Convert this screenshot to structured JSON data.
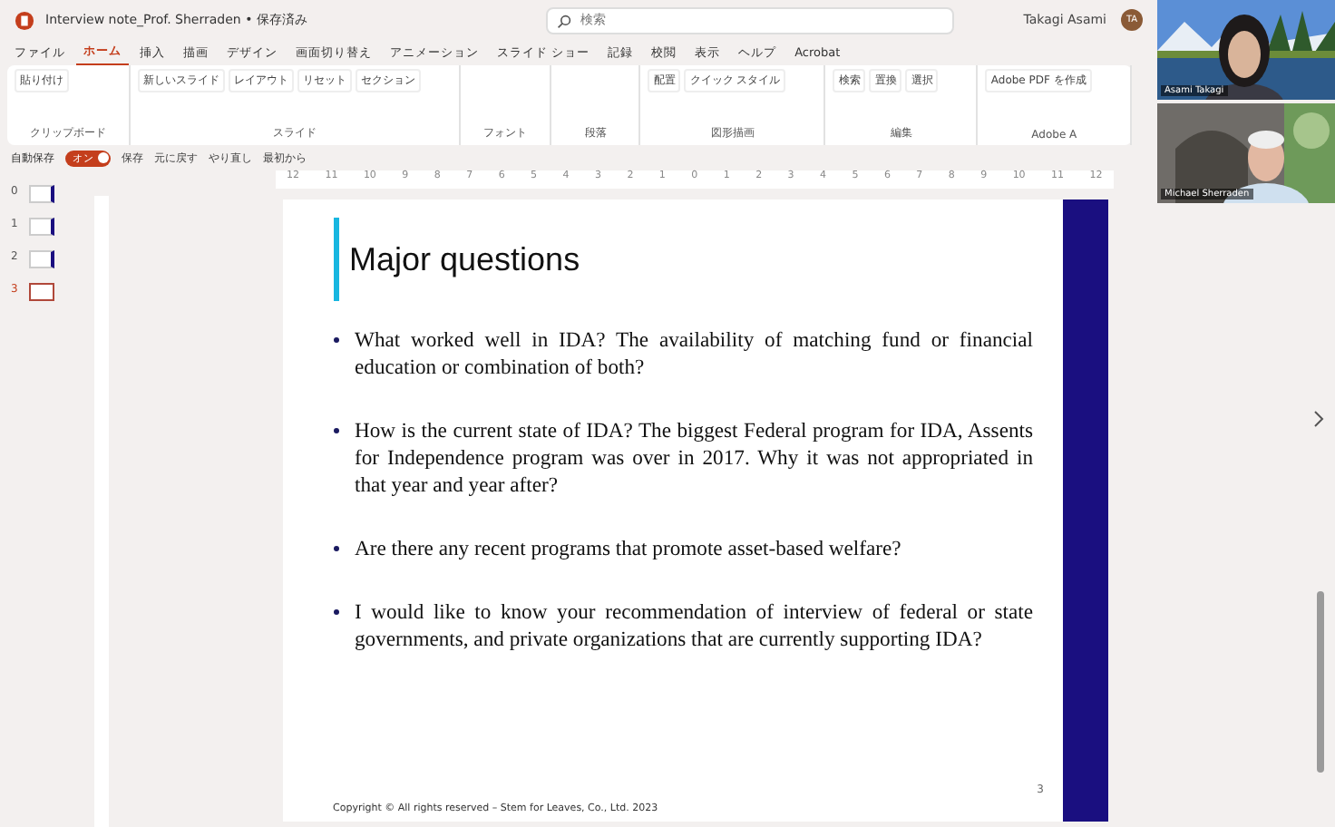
{
  "window": {
    "title": "Interview note_Prof. Sherraden • 保存済み",
    "search_placeholder": "検索",
    "user": "Takagi Asami",
    "avatar": "TA"
  },
  "tabs": [
    {
      "label": "ファイル",
      "selected": false
    },
    {
      "label": "ホーム",
      "selected": true
    },
    {
      "label": "挿入",
      "selected": false
    },
    {
      "label": "描画",
      "selected": false
    },
    {
      "label": "デザイン",
      "selected": false
    },
    {
      "label": "画面切り替え",
      "selected": false
    },
    {
      "label": "アニメーション",
      "selected": false
    },
    {
      "label": "スライド ショー",
      "selected": false
    },
    {
      "label": "記録",
      "selected": false
    },
    {
      "label": "校閲",
      "selected": false
    },
    {
      "label": "表示",
      "selected": false
    },
    {
      "label": "ヘルプ",
      "selected": false
    },
    {
      "label": "Acrobat",
      "selected": false
    }
  ],
  "ribbon": [
    {
      "label": "クリップボード",
      "buttons": [
        "貼り付け"
      ]
    },
    {
      "label": "スライド",
      "buttons": [
        "新しいスライド",
        "レイアウト",
        "リセット",
        "セクション"
      ]
    },
    {
      "label": "フォント"
    },
    {
      "label": "段落"
    },
    {
      "label": "図形描画",
      "buttons": [
        "配置",
        "クイック スタイル"
      ]
    },
    {
      "label": "編集",
      "buttons": [
        "検索",
        "置換",
        "選択"
      ]
    },
    {
      "label": "Adobe A",
      "buttons": [
        "Adobe PDF を作成"
      ]
    }
  ],
  "quick_access": {
    "autosave_label": "自動保存",
    "autosave": {
      "label": "オン",
      "on": true
    },
    "buttons": [
      "保存",
      "元に戻す",
      "やり直し",
      "最初から"
    ]
  },
  "ruler": [
    "12",
    "11",
    "10",
    "9",
    "8",
    "7",
    "6",
    "5",
    "4",
    "3",
    "2",
    "1",
    "0",
    "1",
    "2",
    "3",
    "4",
    "5",
    "6",
    "7",
    "8",
    "9",
    "10",
    "11",
    "12"
  ],
  "thumbnails": [
    {
      "number": "0",
      "selected": false
    },
    {
      "number": "1",
      "selected": false
    },
    {
      "number": "2",
      "selected": false
    },
    {
      "number": "3",
      "selected": true
    }
  ],
  "slide": {
    "title": "Major questions",
    "bullets": [
      "What worked well in IDA? The availability of matching fund or financial education or combination of both?",
      "How is the current state of IDA? The biggest Federal program for IDA, Assents for Independence program was over in 2017. Why it was not appropriated in that year and year after?",
      "Are there any recent programs that promote asset-based welfare?",
      "I would like to know your recommendation of interview of federal or state governments, and private organizations that are currently supporting IDA?"
    ],
    "footer": "Copyright © All rights reserved – Stem for Leaves, Co., Ltd.  2023",
    "page_number": "3"
  },
  "video_tiles": [
    {
      "name": "Asami Takagi",
      "kind": "picture"
    },
    {
      "name": "Michael Sherraden",
      "kind": "picture"
    }
  ]
}
